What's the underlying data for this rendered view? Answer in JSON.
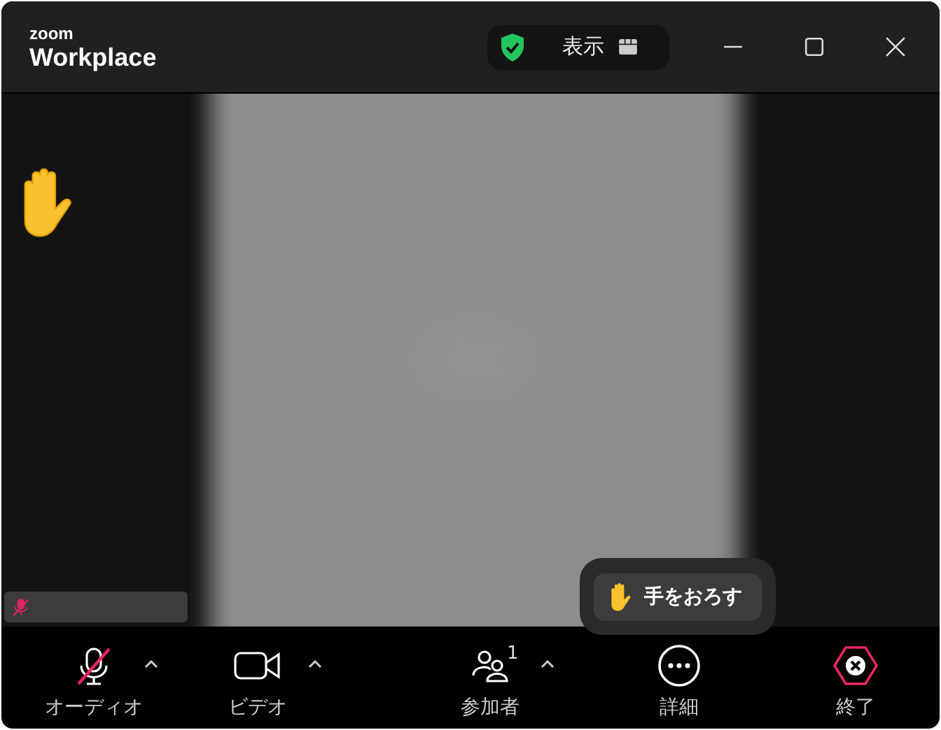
{
  "window": {
    "logo_top": "zoom",
    "logo_bottom": "Workplace",
    "view_button": {
      "label": "表示"
    },
    "security_verified": true
  },
  "video": {
    "kind": "picture",
    "hand_raised": true,
    "name_tag": {
      "muted": true
    }
  },
  "raise_hand_popup": {
    "label": "手をおろす"
  },
  "toolbar": [
    {
      "kind": "audio",
      "label": "オーディオ",
      "muted": true,
      "has_menu": true
    },
    {
      "kind": "video",
      "label": "ビデオ",
      "has_menu": true
    },
    {
      "kind": "participants",
      "label": "参加者",
      "count": "1",
      "has_menu": true
    },
    {
      "kind": "more",
      "label": "詳細",
      "has_menu": false
    },
    {
      "kind": "end",
      "label": "終了",
      "has_menu": false
    }
  ]
}
